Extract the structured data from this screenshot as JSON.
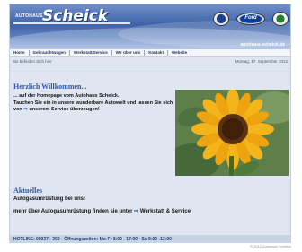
{
  "header": {
    "logo_small": "AUTOHAUS",
    "logo": "Scheick",
    "url": "autohaus-scheick.de",
    "brands": [
      "volkswagen-icon",
      "ford-icon",
      "skoda-icon"
    ],
    "ford_text": "Ford"
  },
  "nav": {
    "items": [
      "Home",
      "Gebrauchtwagen",
      "Werkstatt/Service",
      "Wir über uns",
      "Kontakt",
      "Website"
    ]
  },
  "breadcrumb": "Sie befinden Sich hier",
  "date": "Montag, 17. September 2012",
  "content": {
    "welcome_title": "Herzlich Willkommen...",
    "intro_line1": "... auf der Homepage vom Autohaus Scheick.",
    "intro_line2": "Tauchen Sie ein in unsere wunderbare Autowelt und lassen Sie sich",
    "intro_line3_pre": "von",
    "intro_link": "unserem Service überzeugen!",
    "news_title": "Aktuelles",
    "news_line1": "Autogasumrüstung bei uns!",
    "news_line2_pre": "mehr über Autogasumrüstung finden sie unter",
    "news_link": "Werkstatt & Service"
  },
  "footer": {
    "text": "HOTLINE: 09937 - 362 · Öffnungszeiten: Mo-Fr 8:00 - 17:00 · Sa 9:00 -13:00"
  },
  "copyright": "© 2012 Autohaus Scheick",
  "colors": {
    "accent": "#2a5aa8",
    "header": "#3f63a8",
    "background": "#dfe6f1"
  }
}
